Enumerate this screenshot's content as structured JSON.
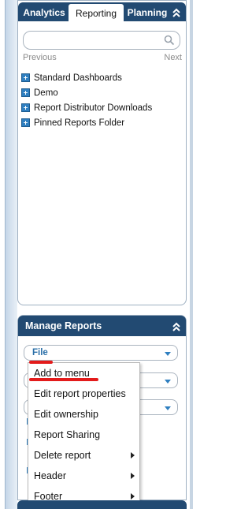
{
  "tabs": [
    {
      "label": "Analytics"
    },
    {
      "label": "Reporting"
    },
    {
      "label": "Planning"
    }
  ],
  "search": {
    "placeholder": "",
    "value": ""
  },
  "pager": {
    "prev": "Previous",
    "next": "Next"
  },
  "tree": [
    {
      "label": "Standard Dashboards"
    },
    {
      "label": "Demo"
    },
    {
      "label": "Report Distributor Downloads"
    },
    {
      "label": "Pinned Reports Folder"
    }
  ],
  "manage": {
    "title": "Manage Reports",
    "file_label": "File"
  },
  "context_menu": [
    {
      "label": "Add to menu",
      "submenu": false
    },
    {
      "label": "Edit report properties",
      "submenu": false
    },
    {
      "label": "Edit ownership",
      "submenu": false
    },
    {
      "label": "Report Sharing",
      "submenu": false
    },
    {
      "label": "Delete report",
      "submenu": true
    },
    {
      "label": "Header",
      "submenu": true
    },
    {
      "label": "Footer",
      "submenu": true
    }
  ],
  "colors": {
    "header_bg": "#224a72",
    "accent": "#2f7fc0",
    "highlight": "#e31b1b"
  }
}
